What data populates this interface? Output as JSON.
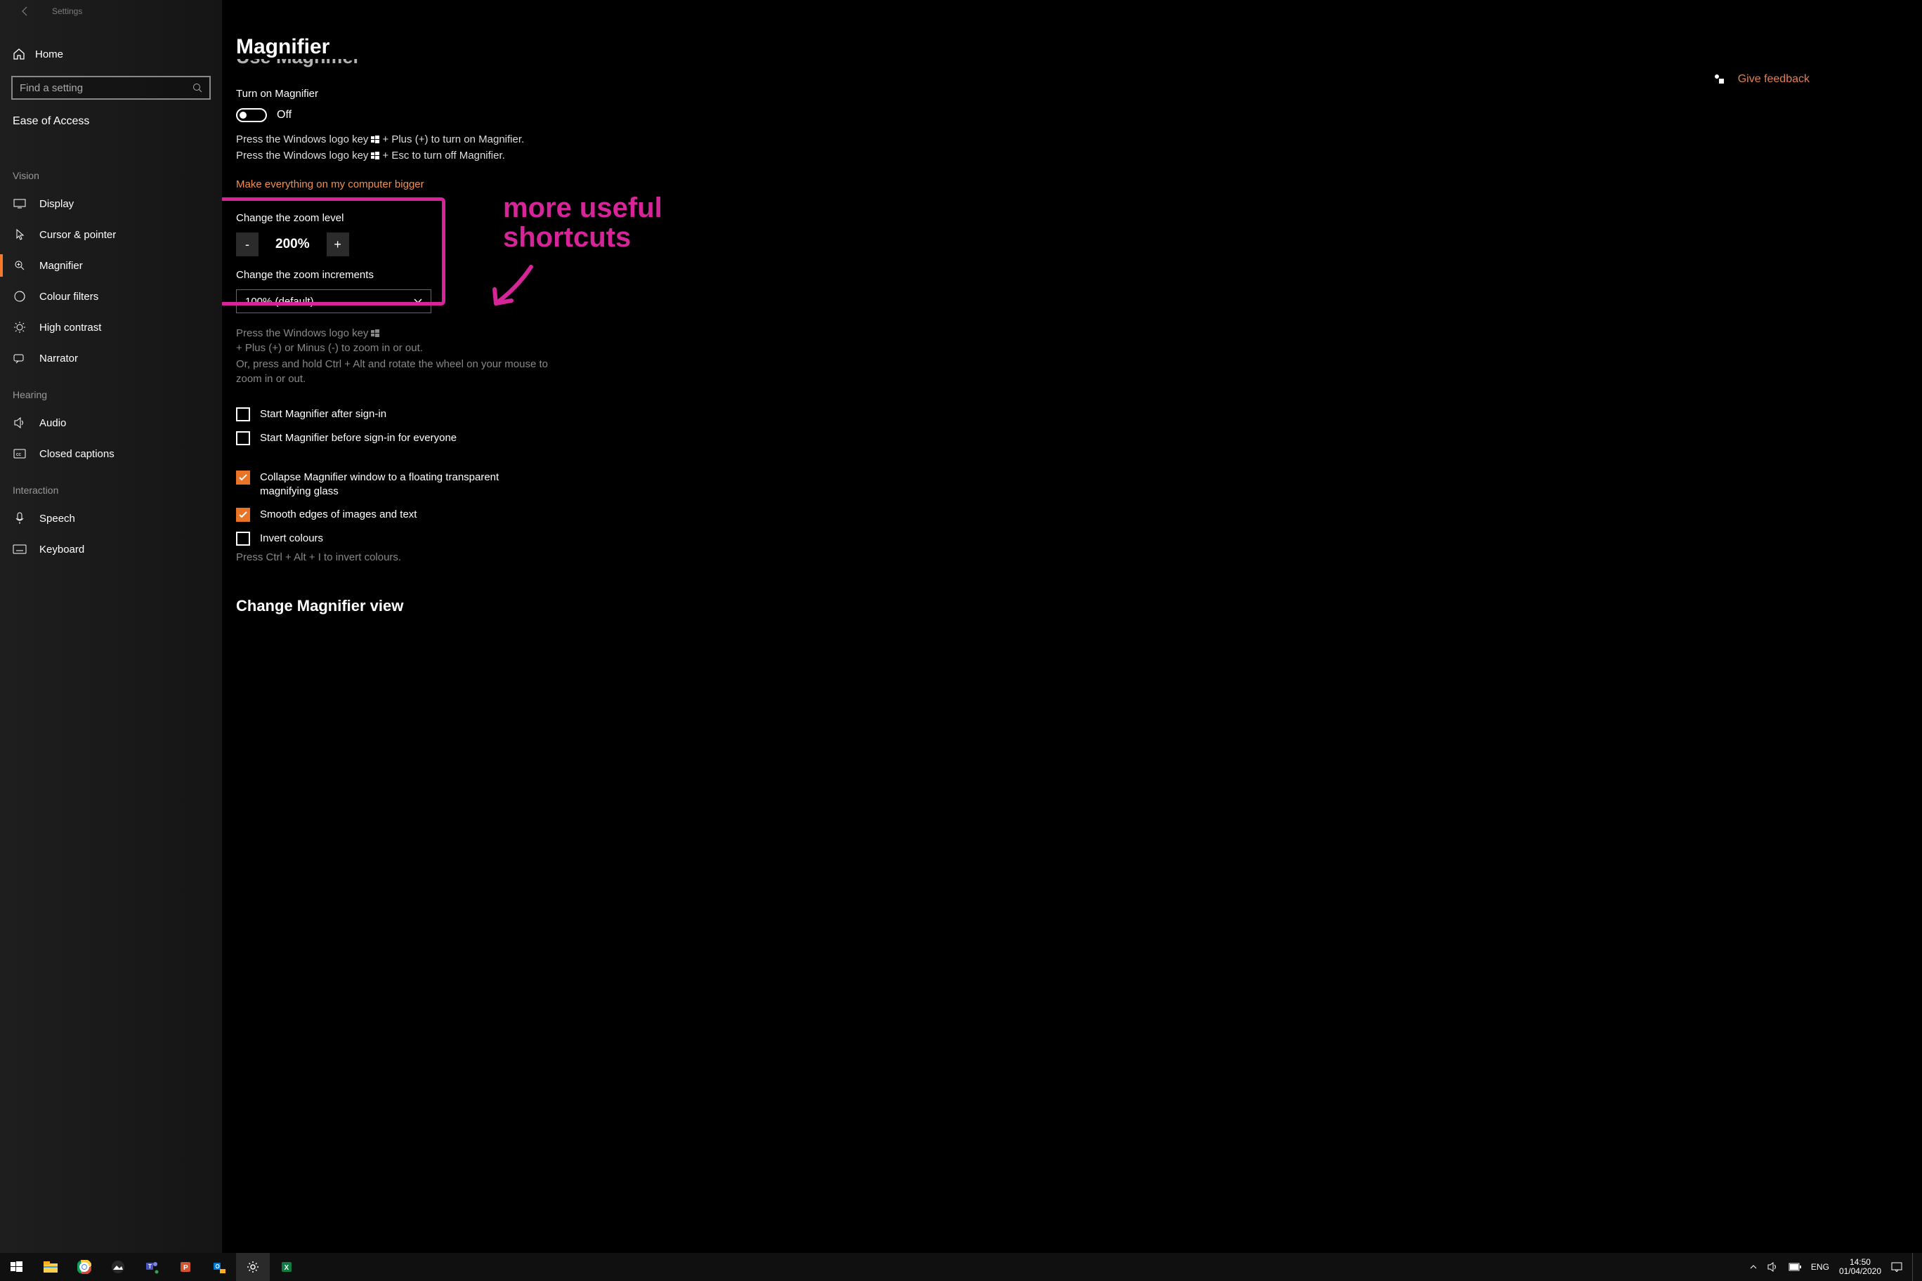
{
  "window": {
    "title": "Settings"
  },
  "feedback_label": "Give feedback",
  "sidebar": {
    "home": "Home",
    "search_placeholder": "Find a setting",
    "section": "Ease of Access",
    "groups": [
      {
        "label": "Vision",
        "items": [
          {
            "key": "display",
            "label": "Display"
          },
          {
            "key": "cursor",
            "label": "Cursor & pointer"
          },
          {
            "key": "magnifier",
            "label": "Magnifier",
            "active": true
          },
          {
            "key": "colour-filters",
            "label": "Colour filters"
          },
          {
            "key": "high-contrast",
            "label": "High contrast"
          },
          {
            "key": "narrator",
            "label": "Narrator"
          }
        ]
      },
      {
        "label": "Hearing",
        "items": [
          {
            "key": "audio",
            "label": "Audio"
          },
          {
            "key": "closed-captions",
            "label": "Closed captions"
          }
        ]
      },
      {
        "label": "Interaction",
        "items": [
          {
            "key": "speech",
            "label": "Speech"
          },
          {
            "key": "keyboard",
            "label": "Keyboard"
          }
        ]
      }
    ]
  },
  "main": {
    "heading": "Magnifier",
    "truncated_section": "Use Magnifier",
    "turn_on_label": "Turn on Magnifier",
    "toggle_state": "Off",
    "hint_on_prefix": "Press the Windows logo key ",
    "hint_on_suffix": " + Plus (+) to turn on Magnifier.",
    "hint_off_prefix": "Press the Windows logo key ",
    "hint_off_suffix": " + Esc to turn off Magnifier.",
    "bigger_link": "Make everything on my computer bigger",
    "zoom_level_label": "Change the zoom level",
    "zoom_value": "200%",
    "zoom_minus": "-",
    "zoom_plus": "+",
    "zoom_incr_label": "Change the zoom increments",
    "zoom_incr_value": "100% (default)",
    "hint_zoom_prefix": "Press the Windows logo key ",
    "hint_zoom_suffix": " + Plus (+) or Minus (-) to zoom in or out.",
    "hint_wheel": "Or, press and hold Ctrl + Alt and rotate the wheel on your mouse to zoom in or out.",
    "checks": {
      "after_signin": "Start Magnifier after sign-in",
      "before_signin": "Start Magnifier before sign-in for everyone",
      "collapse": "Collapse Magnifier window to a floating transparent magnifying glass",
      "smooth": "Smooth edges of images and text",
      "invert": "Invert colours"
    },
    "invert_hint": "Press Ctrl + Alt + I to invert colours.",
    "view_heading": "Change Magnifier view"
  },
  "annotation": {
    "text_line1": "more useful",
    "text_line2": "shortcuts"
  },
  "taskbar": {
    "lang": "ENG",
    "time": "14:50",
    "date": "01/04/2020"
  }
}
